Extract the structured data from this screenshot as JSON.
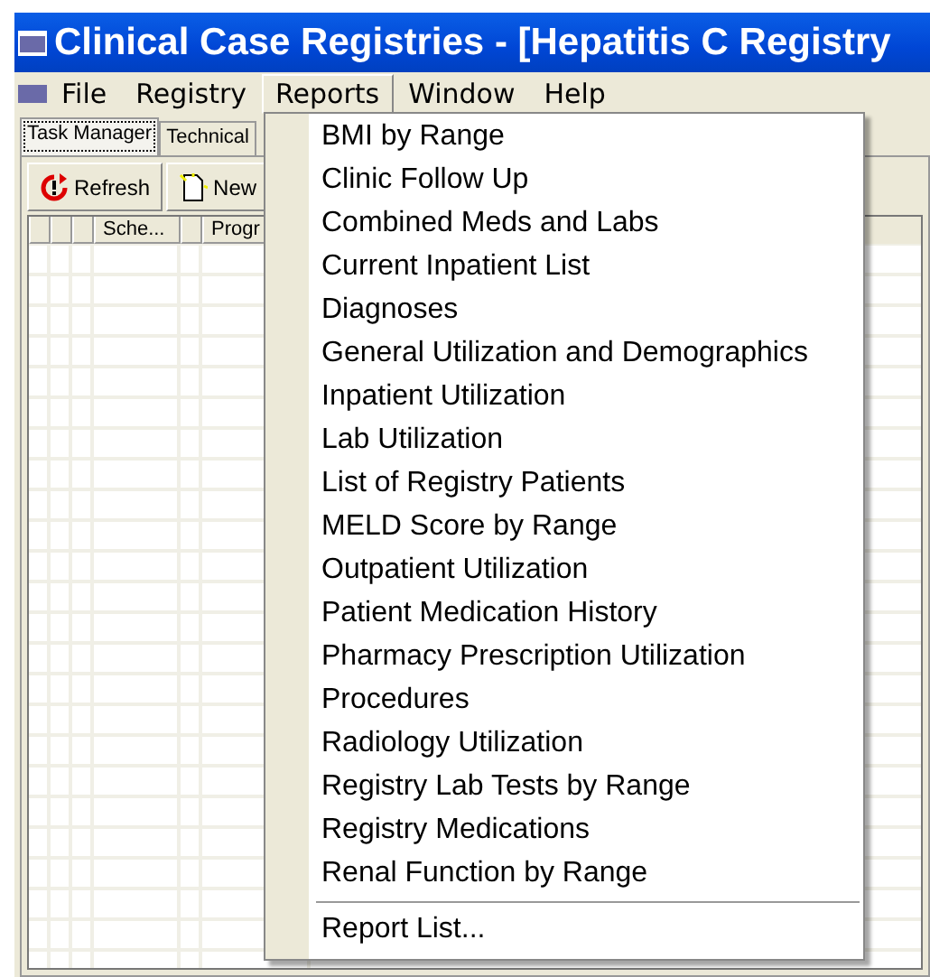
{
  "window": {
    "title": "Clinical Case Registries - [Hepatitis C Registry"
  },
  "menubar": [
    {
      "label": "File",
      "selected": false
    },
    {
      "label": "Registry",
      "selected": false
    },
    {
      "label": "Reports",
      "selected": true
    },
    {
      "label": "Window",
      "selected": false
    },
    {
      "label": "Help",
      "selected": false
    }
  ],
  "tabs": [
    {
      "label": "Task Manager",
      "selected": true
    },
    {
      "label": "Technical",
      "selected": false
    }
  ],
  "toolbar": [
    {
      "label": "Refresh",
      "kind": "refresh"
    },
    {
      "label": "New",
      "kind": "new"
    }
  ],
  "table": {
    "columns": [
      "",
      "",
      "",
      "Sche...",
      "",
      "Progr"
    ]
  },
  "reports_menu": {
    "items": [
      {
        "label": "BMI by Range"
      },
      {
        "label": "Clinic Follow Up"
      },
      {
        "label": "Combined Meds and Labs"
      },
      {
        "label": "Current Inpatient List"
      },
      {
        "label": "Diagnoses"
      },
      {
        "label": "General Utilization and Demographics"
      },
      {
        "label": "Inpatient Utilization"
      },
      {
        "label": "Lab Utilization"
      },
      {
        "label": "List of Registry Patients"
      },
      {
        "label": "MELD Score by Range"
      },
      {
        "label": "Outpatient Utilization"
      },
      {
        "label": "Patient Medication History"
      },
      {
        "label": "Pharmacy Prescription Utilization"
      },
      {
        "label": "Procedures"
      },
      {
        "label": "Radiology Utilization"
      },
      {
        "label": "Registry Lab Tests by Range"
      },
      {
        "label": "Registry Medications"
      },
      {
        "label": "Renal Function by Range"
      }
    ],
    "footer_item": {
      "label": "Report List..."
    }
  }
}
